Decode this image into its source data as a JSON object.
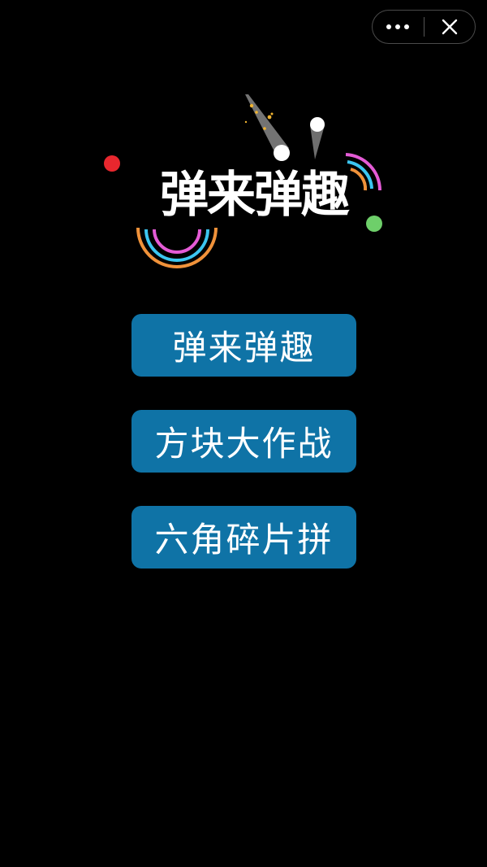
{
  "capsule": {
    "more_icon": "more-dots-icon",
    "close_icon": "close-icon"
  },
  "logo": {
    "title": "弹来弹趣"
  },
  "menu": {
    "items": [
      {
        "label": "弹来弹趣"
      },
      {
        "label": "方块大作战"
      },
      {
        "label": "六角碎片拼"
      }
    ]
  },
  "colors": {
    "background": "#000000",
    "button": "#0f73a6",
    "button_text": "#ffffff",
    "accent_red": "#e8272e",
    "accent_green": "#6ecf6a",
    "ring_orange": "#f0923a",
    "ring_pink": "#e45bd6",
    "ring_cyan": "#3cc6f0"
  }
}
